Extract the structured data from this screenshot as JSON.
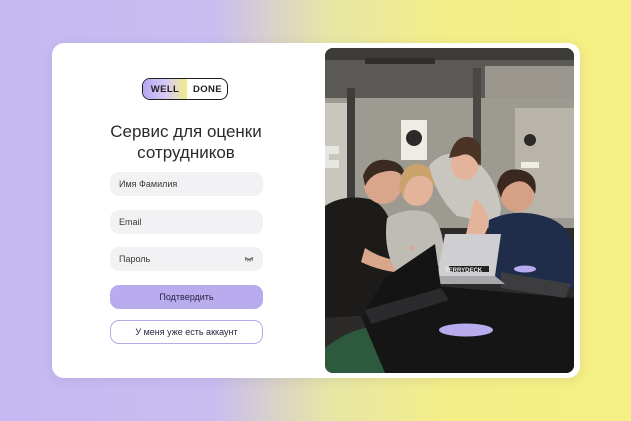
{
  "brand": {
    "left": "WELL",
    "right": "DONE"
  },
  "heading": {
    "line1": "Сервис для оценки",
    "line2": "сотрудников"
  },
  "form": {
    "name_placeholder": "Имя Фамилия",
    "email_placeholder": "Email",
    "password_placeholder": "Пароль",
    "password_icon": "eye-closed-icon"
  },
  "actions": {
    "submit_label": "Подтвердить",
    "login_label": "У меня уже есть аккаунт"
  },
  "laptop_sticker": "TERRYDECK",
  "colors": {
    "accent": "#b8abee",
    "accent_border": "#b6aae8",
    "field_bg": "#f2f2f4",
    "bg_left": "#c6b8f3",
    "bg_right": "#f5ef84"
  }
}
